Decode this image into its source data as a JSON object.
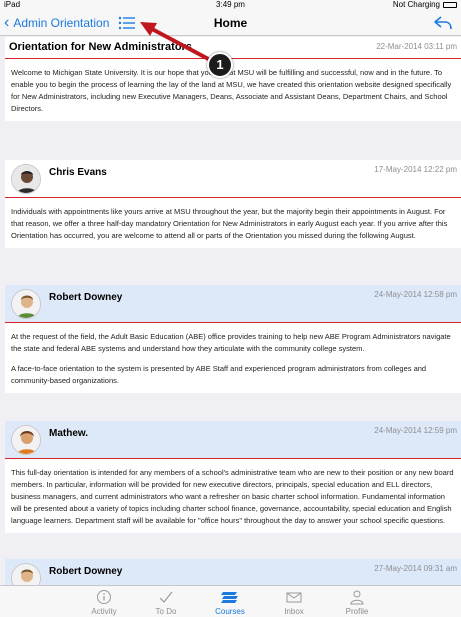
{
  "statusbar": {
    "device": "iPad",
    "time": "3:49 pm",
    "charging": "Not Charging"
  },
  "navbar": {
    "back_label": "Admin Orientation",
    "title": "Home"
  },
  "posts": [
    {
      "title": "Orientation for New Administrators",
      "date": "22-Mar-2014 03:11 pm",
      "paragraphs": [
        "Welcome to Michigan State University. It is our hope that your life at MSU will be fulfilling and successful, now and in the future.  To enable you to begin the process of learning the lay of the land at MSU, we have created this orientation website designed specifically for New Administrators, including new Executive Managers, Deans, Associate and Assistant Deans, Department Chairs, and School Directors."
      ]
    },
    {
      "name": "Chris Evans",
      "date": "17-May-2014 12:22 pm",
      "paragraphs": [
        "Individuals with appointments like yours arrive at MSU throughout the year, but the majority begin their appointments in August.  For that reason, we offer a three half-day mandatory Orientation for New Administrators in early August each year.  If you arrive after this Orientation has occurred, you are welcome to attend all or parts of the Orientation you missed during the following August."
      ]
    },
    {
      "name": "Robert Downey",
      "date": "24-May-2014 12:58 pm",
      "paragraphs": [
        "At the request of the field, the Adult Basic Education (ABE) office provides training to help new ABE Program Administrators navigate the state and federal ABE systems and understand how they articulate with the community college system.",
        "A face-to-face orientation to the system is presented by ABE Staff and experienced program administrators from colleges and community-based organizations."
      ]
    },
    {
      "name": "Mathew.",
      "date": "24-May-2014 12:59 pm",
      "paragraphs": [
        "This full-day orientation is intended for any members of a school's administrative team who are new to their position or any new board members. In particular, information will be provided for new executive directors, principals, special education and ELL directors, business managers, and current administrators who want a refresher on basic charter school information. Fundamental information will be presented about a variety of topics including charter school finance, governance, accountability, special education and English language learners. Department staff will be available for \"office hours\" throughout the day to answer your school specific questions."
      ]
    },
    {
      "name": "Robert Downey",
      "date": "27-May-2014 09:31 am",
      "paragraphs": []
    }
  ],
  "tabs": [
    {
      "label": "Activity",
      "icon": "info-icon"
    },
    {
      "label": "To Do",
      "icon": "checkmark-icon"
    },
    {
      "label": "Courses",
      "icon": "courses-stack-icon"
    },
    {
      "label": "Inbox",
      "icon": "inbox-icon"
    },
    {
      "label": "Profile",
      "icon": "profile-icon"
    }
  ],
  "callout": {
    "number": "1"
  },
  "colors": {
    "accent": "#1a7ae0",
    "divider": "#d8232a",
    "highlight": "#dde9f8",
    "callout_arrow": "#c0161d"
  }
}
